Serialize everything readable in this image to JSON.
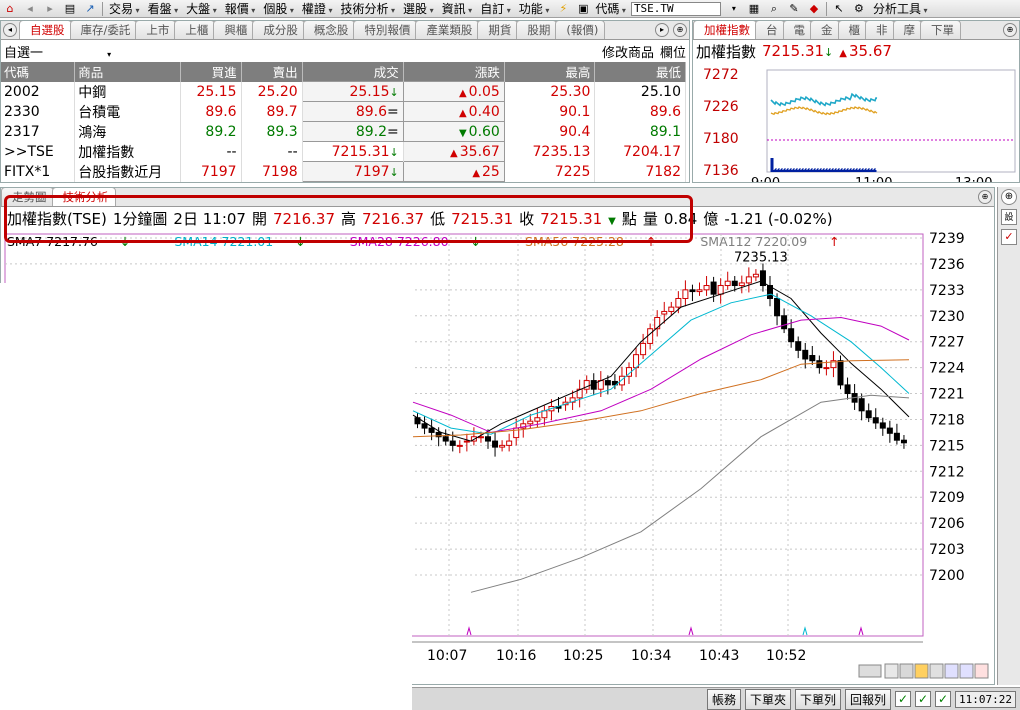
{
  "menubar": {
    "items": [
      "交易",
      "看盤",
      "大盤",
      "報價",
      "個股",
      "權證",
      "技術分析",
      "選股",
      "資訊",
      "自訂",
      "功能"
    ],
    "code_label": "代碼",
    "code_value": "TSE.TW",
    "analysis_tools": "分析工具"
  },
  "quote": {
    "tabs": [
      "自選股",
      "庫存/委託",
      "上市",
      "上櫃",
      "興櫃",
      "成分股",
      "概念股",
      "特別報價",
      "產業類股",
      "期貨",
      "股期",
      "(報價)"
    ],
    "list_name": "自選一",
    "modify_label": "修改商品",
    "column_label": "欄位",
    "columns": [
      "代碼",
      "商品",
      "買進",
      "賣出",
      "成交",
      "漲跌",
      "最高",
      "最低"
    ],
    "rows": [
      {
        "code": "2002",
        "name": "中鋼",
        "bid": "25.15",
        "ask": "25.20",
        "last": "25.15",
        "last_arrow": "↓",
        "chg": "0.05",
        "high": "25.30",
        "low": "25.10"
      },
      {
        "code": "2330",
        "name": "台積電",
        "bid": "89.6",
        "ask": "89.7",
        "last": "89.6",
        "last_arrow": "=",
        "chg": "0.40",
        "high": "90.1",
        "low": "89.6"
      },
      {
        "code": "2317",
        "name": "鴻海",
        "bid": "89.2",
        "ask": "89.3",
        "last": "89.2",
        "last_arrow": "=",
        "chg": "0.60",
        "high": "90.4",
        "low": "89.1"
      },
      {
        "code": ">>TSE",
        "name": "加權指數",
        "bid": "--",
        "ask": "--",
        "last": "7215.31",
        "last_arrow": "↓",
        "chg": "35.67",
        "high": "7235.13",
        "low": "7204.17"
      },
      {
        "code": "FITX*1",
        "name": "台股指數近月",
        "bid": "7197",
        "ask": "7198",
        "last": "7197",
        "last_arrow": "↓",
        "chg": "25",
        "high": "7225",
        "low": "7182"
      }
    ]
  },
  "mini": {
    "tabs": [
      "加權指數",
      "台",
      "電",
      "金",
      "櫃",
      "非",
      "摩",
      "下單"
    ],
    "title": "加權指數",
    "price": "7215.31",
    "price_arrow": "↓",
    "change": "35.67",
    "y_ticks": [
      "7272",
      "7226",
      "7180",
      "7136"
    ],
    "x_ticks": [
      "9:00",
      "11:00",
      "13:00"
    ]
  },
  "ta": {
    "tabs": [
      "走勢圖",
      "技術分析"
    ],
    "info": {
      "symbol": "加權指數(TSE)",
      "period": "1分鐘圖",
      "date": "2日 11:07",
      "open_label": "開",
      "open": "7216.37",
      "high_label": "高",
      "high": "7216.37",
      "low_label": "低",
      "low": "7215.31",
      "close_label": "收",
      "close": "7215.31",
      "unit": "點",
      "vol_label": "量",
      "vol": "0.84",
      "vol_unit": "億",
      "change": "-1.21 (-0.02%)"
    },
    "ma": [
      "SMA7 7217.76",
      "SMA14 7221.01",
      "SMA28 7226.80",
      "SMA56 7225.28",
      "SMA112 7220.09"
    ],
    "peak_label": "7235.13",
    "y_ticks": [
      "7239",
      "7236",
      "7233",
      "7230",
      "7227",
      "7224",
      "7221",
      "7218",
      "7215",
      "7212",
      "7209",
      "7206",
      "7203",
      "7200"
    ],
    "x_ticks": [
      "10:07",
      "10:16",
      "10:25",
      "10:34",
      "10:43",
      "10:52"
    ]
  },
  "status": {
    "buttons": [
      "帳務",
      "下單夾",
      "下單列",
      "回報列"
    ],
    "time": "11:07:22"
  }
}
